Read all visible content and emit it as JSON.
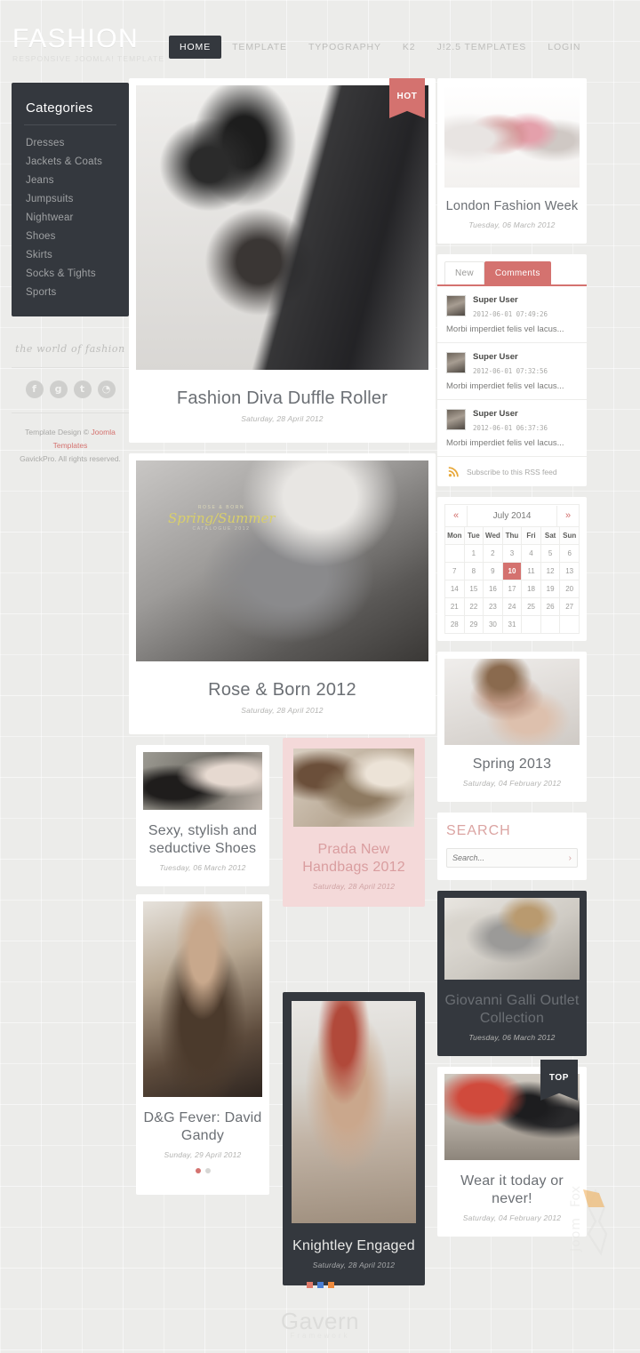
{
  "header": {
    "logo_main": "FASHION",
    "logo_sub": "RESPONSIVE JOOMLA! TEMPLATE",
    "menu": [
      {
        "label": "HOME",
        "active": true
      },
      {
        "label": "TEMPLATE",
        "active": false
      },
      {
        "label": "TYPOGRAPHY",
        "active": false
      },
      {
        "label": "K2",
        "active": false
      },
      {
        "label": "J!2.5 TEMPLATES",
        "active": false
      },
      {
        "label": "LOGIN",
        "active": false
      }
    ]
  },
  "sidebar": {
    "categories_title": "Categories",
    "categories": [
      {
        "label": "Dresses"
      },
      {
        "label": "Jackets & Coats"
      },
      {
        "label": "Jeans"
      },
      {
        "label": "Jumpsuits"
      },
      {
        "label": "Nightwear"
      },
      {
        "label": "Shoes"
      },
      {
        "label": "Skirts"
      },
      {
        "label": "Socks & Tights"
      },
      {
        "label": "Sports"
      }
    ],
    "slogan": "the world of fashion",
    "social": [
      {
        "name": "facebook-icon",
        "glyph": "f"
      },
      {
        "name": "google-plus-icon",
        "glyph": "g"
      },
      {
        "name": "twitter-icon",
        "glyph": "t"
      },
      {
        "name": "rss-icon",
        "glyph": "◔"
      }
    ],
    "copyright_line1_prefix": "Template Design © ",
    "copyright_link": "Joomla Templates",
    "copyright_line2": "GavickPro. All rights reserved."
  },
  "main": {
    "hot_badge": "HOT",
    "articles": [
      {
        "title": "Fashion Diva Duffle Roller",
        "date": "Saturday, 28 April 2012",
        "style": "white"
      },
      {
        "title": "Rose & Born 2012",
        "date": "Saturday, 28 April 2012",
        "style": "white",
        "overlay_line1": "ROSE & BORN",
        "overlay_line2": "Spring/Summer",
        "overlay_line3": "CATALOGUE 2012"
      },
      {
        "title": "Sexy, stylish and seductive Shoes",
        "date": "Tuesday, 06 March 2012",
        "style": "white"
      },
      {
        "title": "Prada New Handbags 2012",
        "date": "Saturday, 28 April 2012",
        "style": "pink"
      },
      {
        "title": "D&G Fever: David Gandy",
        "date": "Sunday, 29 April 2012",
        "style": "white"
      },
      {
        "title": "Knightley Engaged",
        "date": "Saturday, 28 April 2012",
        "style": "dark"
      }
    ]
  },
  "right": {
    "featured": {
      "title": "London Fashion Week",
      "date": "Tuesday, 06 March 2012"
    },
    "tabs_module": {
      "tabs": [
        {
          "label": "New",
          "active": false
        },
        {
          "label": "Comments",
          "active": true
        }
      ],
      "comments": [
        {
          "user": "Super User",
          "time": "2012-06-01 07:49:26",
          "text": "Morbi imperdiet felis vel lacus..."
        },
        {
          "user": "Super User",
          "time": "2012-06-01 07:32:56",
          "text": "Morbi imperdiet felis vel lacus..."
        },
        {
          "user": "Super User",
          "time": "2012-06-01 06:37:36",
          "text": "Morbi imperdiet felis vel lacus..."
        }
      ],
      "rss_label": "Subscribe to this RSS feed"
    },
    "calendar": {
      "prev": "«",
      "next": "»",
      "month": "July 2014",
      "weekdays": [
        "Mon",
        "Tue",
        "Wed",
        "Thu",
        "Fri",
        "Sat",
        "Sun"
      ],
      "weeks": [
        [
          "",
          "1",
          "2",
          "3",
          "4",
          "5",
          "6"
        ],
        [
          "7",
          "8",
          "9",
          "10",
          "11",
          "12",
          "13"
        ],
        [
          "14",
          "15",
          "16",
          "17",
          "18",
          "19",
          "20"
        ],
        [
          "21",
          "22",
          "23",
          "24",
          "25",
          "26",
          "27"
        ],
        [
          "28",
          "29",
          "30",
          "31",
          "",
          "",
          ""
        ]
      ],
      "today": "10"
    },
    "spring": {
      "title": "Spring 2013",
      "date": "Saturday, 04 February 2012"
    },
    "search": {
      "title": "SEARCH",
      "placeholder": "Search...",
      "value": "",
      "go_glyph": "›"
    },
    "giovanni": {
      "title": "Giovanni Galli Outlet Collection",
      "date": "Tuesday, 06 March 2012"
    },
    "wear": {
      "title": "Wear it today or never!",
      "date": "Saturday, 04 February 2012",
      "top_badge": "TOP"
    }
  },
  "footer": {
    "dots": [
      "#e07a6a",
      "#4a7fd4",
      "#ef8a3c"
    ],
    "brand": "Gavern",
    "brand_sub": "Framework"
  },
  "colors": {
    "accent": "#d4726f",
    "dark": "#34383e",
    "pink": "#f4d9d9",
    "page_bg": "#ececea"
  }
}
